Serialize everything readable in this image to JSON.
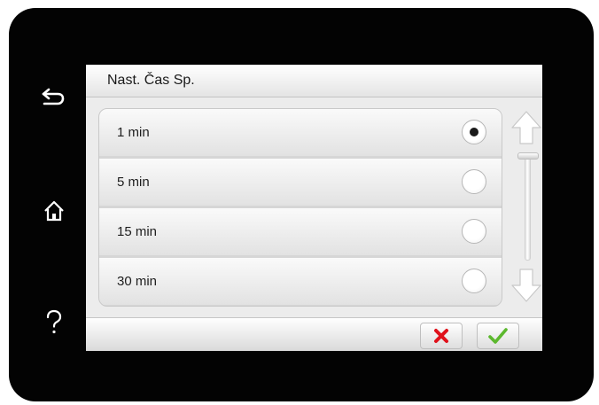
{
  "device": {
    "back_icon": "back-arrow-icon",
    "home_icon": "home-icon",
    "help_icon": "help-icon"
  },
  "screen": {
    "title": "Nast. Čas Sp.",
    "options": [
      {
        "label": "1 min",
        "selected": true
      },
      {
        "label": "5 min",
        "selected": false
      },
      {
        "label": "15 min",
        "selected": false
      },
      {
        "label": "30 min",
        "selected": false
      }
    ],
    "scroll": {
      "up_icon": "arrow-up-icon",
      "down_icon": "arrow-down-icon"
    },
    "buttons": {
      "cancel_icon": "cross-icon",
      "ok_icon": "checkmark-icon"
    }
  },
  "colors": {
    "device_frame": "#030303",
    "cancel": "#e0111b",
    "confirm": "#5cb82e"
  }
}
